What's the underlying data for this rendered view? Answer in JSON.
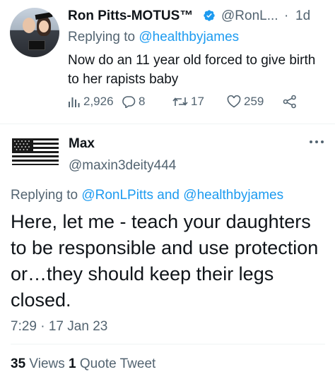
{
  "parent_tweet": {
    "display_name": "Ron Pitts-MOTUS™",
    "handle": "@RonL...",
    "separator": "·",
    "time_ago": "1d",
    "replying_prefix": "Replying to ",
    "replying_to": "@healthbyjames",
    "text": "Now do an 11 year old forced to give birth to her rapists baby",
    "views": "2,926",
    "replies": "8",
    "retweets": "17",
    "likes": "259",
    "icons": [
      "verified-badge-icon",
      "views-icon",
      "reply-icon",
      "retweet-icon",
      "like-icon",
      "share-icon"
    ]
  },
  "main_tweet": {
    "display_name": "Max",
    "handle": "@maxin3deity444",
    "replying_prefix": "Replying to ",
    "replying_to_1": "@RonLPitts",
    "replying_and": " and ",
    "replying_to_2": "@healthbyjames",
    "text": "Here, let me - teach your daughters to be responsible and use protection or…they should keep their legs closed.",
    "timestamp": "7:29 · 17 Jan 23",
    "views_count": "35",
    "views_label": " Views ",
    "quote_count": "1",
    "quote_label": " Quote Tweet",
    "icons": [
      "flag-avatar-icon",
      "more-options-icon"
    ]
  },
  "colors": {
    "text": "#0f1419",
    "secondary": "#536471",
    "link": "#1d9bf0",
    "divider": "#eff3f4"
  }
}
